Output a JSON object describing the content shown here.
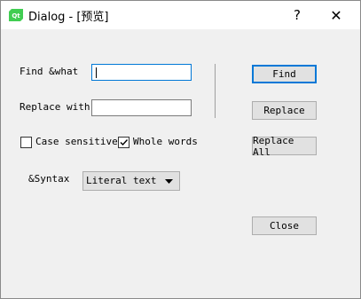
{
  "window": {
    "title": "Dialog - [预览]",
    "app_icon_text": "Qt",
    "help_glyph": "?",
    "close_glyph": "✕"
  },
  "find": {
    "label": "Find &what",
    "value": ""
  },
  "replace": {
    "label": "Replace with",
    "value": ""
  },
  "options": {
    "case_sensitive_label": "Case sensitive",
    "case_sensitive_checked": false,
    "whole_words_label": "Whole words",
    "whole_words_checked": true
  },
  "syntax": {
    "label": "&Syntax",
    "selected": "Literal text"
  },
  "buttons": {
    "find": "Find",
    "replace": "Replace",
    "replace_all": "Replace All",
    "close": "Close"
  },
  "colors": {
    "accent": "#0078d7",
    "app_icon": "#41cd52"
  }
}
